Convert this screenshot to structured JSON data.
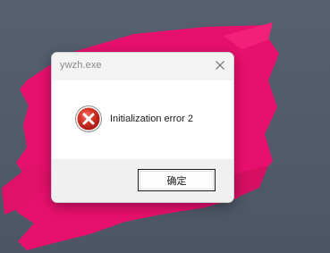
{
  "desktop": {
    "background_color": "#4f5866",
    "brush_color": "#e8106e"
  },
  "dialog": {
    "title": "ywzh.exe",
    "close_icon": "close-icon",
    "icon": "error-icon",
    "message": "Initialization error 2",
    "ok_label": "确定"
  },
  "colors": {
    "error_red": "#c42b1c",
    "title_text": "#8a8a8a",
    "footer_bg": "#f0f0f0"
  }
}
